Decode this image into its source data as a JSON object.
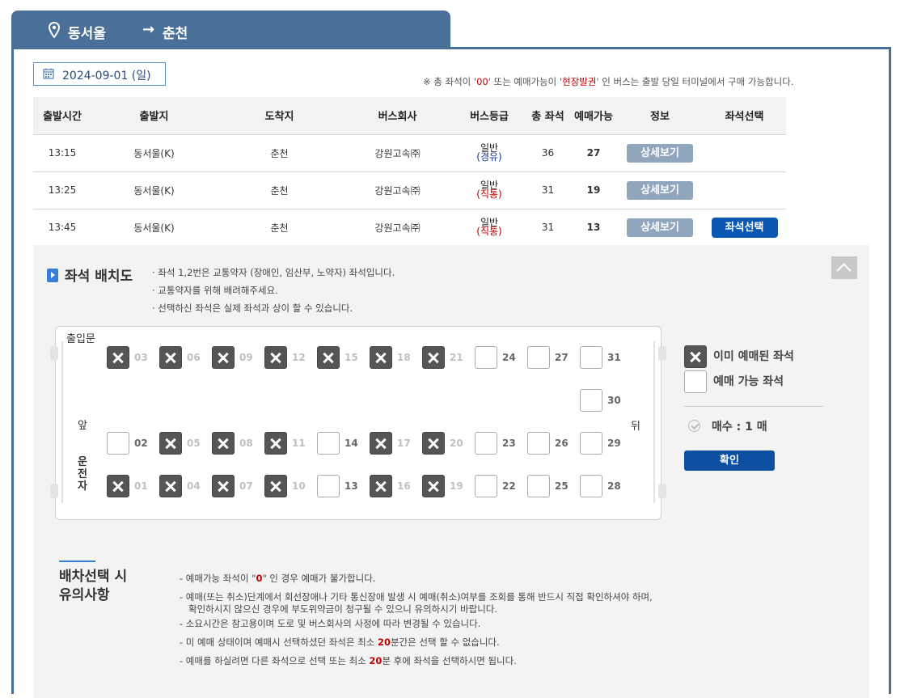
{
  "route": {
    "from": "동서울",
    "arrow": "→",
    "to": "춘천"
  },
  "date": "2024-09-01 (일)",
  "notice": {
    "p1": "※ 총 좌석이 '",
    "v1": "00",
    "p2": "' 또는 예매가능이 '",
    "v2": "현장발권",
    "p3": "' 인 버스는 출발 당일 터미널에서 구매 가능합니다."
  },
  "table": {
    "headers": [
      "출발시간",
      "출발지",
      "도착지",
      "버스회사",
      "버스등급",
      "총 좌석",
      "예매가능",
      "정보",
      "좌석선택"
    ],
    "rows": [
      {
        "time": "13:15",
        "origin": "동서울(K)",
        "dest": "춘천",
        "company": "강원고속㈜",
        "grade": "일반",
        "grade_sub": "(경유)",
        "total": "36",
        "avail": "27",
        "detail": "상세보기",
        "select": ""
      },
      {
        "time": "13:25",
        "origin": "동서울(K)",
        "dest": "춘천",
        "company": "강원고속㈜",
        "grade": "일반",
        "grade_sub": "(직통)",
        "total": "31",
        "avail": "19",
        "detail": "상세보기",
        "select": ""
      },
      {
        "time": "13:45",
        "origin": "동서울(K)",
        "dest": "춘천",
        "company": "강원고속㈜",
        "grade": "일반",
        "grade_sub": "(직통)",
        "total": "31",
        "avail": "13",
        "detail": "상세보기",
        "select": "좌석선택"
      }
    ]
  },
  "seatmap": {
    "title": "좌석 배치도",
    "bullets": [
      "· 좌석 1,2번은 교통약자 (장애인, 임산부, 노약자) 좌석입니다.",
      "· 교통약자를 위해 배려해주세요.",
      "· 선택하신 좌석은 실제 좌석과 상이 할 수 있습니다."
    ],
    "entrance": "출입문",
    "front": "앞",
    "back": "뒤",
    "driver": [
      "운",
      "전",
      "자"
    ],
    "seats": [
      {
        "n": "03",
        "taken": true
      },
      {
        "n": "06",
        "taken": true
      },
      {
        "n": "09",
        "taken": true
      },
      {
        "n": "12",
        "taken": true
      },
      {
        "n": "15",
        "taken": true
      },
      {
        "n": "18",
        "taken": true
      },
      {
        "n": "21",
        "taken": true
      },
      {
        "n": "24",
        "taken": false
      },
      {
        "n": "27",
        "taken": false
      },
      {
        "n": "31",
        "taken": false
      },
      {
        "n": "30",
        "taken": false
      },
      {
        "n": "02",
        "taken": false
      },
      {
        "n": "05",
        "taken": true
      },
      {
        "n": "08",
        "taken": true
      },
      {
        "n": "11",
        "taken": true
      },
      {
        "n": "14",
        "taken": false
      },
      {
        "n": "17",
        "taken": true
      },
      {
        "n": "20",
        "taken": true
      },
      {
        "n": "23",
        "taken": false
      },
      {
        "n": "26",
        "taken": false
      },
      {
        "n": "29",
        "taken": false
      },
      {
        "n": "01",
        "taken": true
      },
      {
        "n": "04",
        "taken": true
      },
      {
        "n": "07",
        "taken": true
      },
      {
        "n": "10",
        "taken": true
      },
      {
        "n": "13",
        "taken": false
      },
      {
        "n": "16",
        "taken": true
      },
      {
        "n": "19",
        "taken": true
      },
      {
        "n": "22",
        "taken": false
      },
      {
        "n": "25",
        "taken": false
      },
      {
        "n": "28",
        "taken": false
      }
    ],
    "legend_taken": "이미 예매된 좌석",
    "legend_free": "예매 가능 좌석",
    "count_label": "매수 : 1 매",
    "confirm": "확인"
  },
  "cautions": {
    "title1": "배차선택 시",
    "title2": "유의사항",
    "c1a": "- 예매가능 좌석이 \"",
    "c1b": "0",
    "c1c": "\" 인 경우 예매가 불가합니다.",
    "c2": "- 예매(또는 취소)단계에서 회선장애나 기타 통신장애 발생 시 예매(취소)여부를 조회를 통해 반드시 직접 확인하셔야 하며,",
    "c2b": "확인하시지 않으신 경우에 부도위약금이 청구될 수 있으니 유의하시기 바랍니다.",
    "c3": "- 소요시간은 참고용이며 도로 및 버스회사의 사정에 따라 변경될 수 있습니다.",
    "c4a": "- 미 예매 상태이며 예매시 선택하셨던 좌석은 최소 ",
    "c4b": "20",
    "c4c": "분간은 선택 할 수 없습니다.",
    "c5a": "- 예매를 하실려면 다른 좌석으로 선택 또는 최소 ",
    "c5b": "20",
    "c5c": "분 후에 좌석을 선택하시면 됩니다."
  }
}
